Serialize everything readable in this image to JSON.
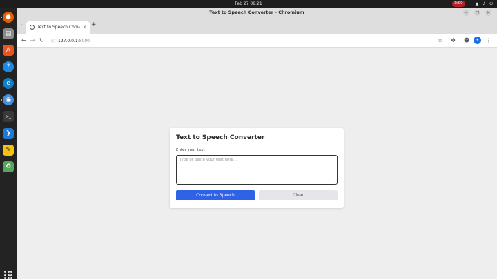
{
  "system": {
    "clock": "Feb 27  08:21",
    "recording_badge": "0:00"
  },
  "dock": {
    "apps": [
      {
        "name": "firefox-icon",
        "color": "#e66000"
      },
      {
        "name": "files-icon",
        "color": "#8a8a8a"
      },
      {
        "name": "app-center-icon",
        "color": "#e95420"
      },
      {
        "name": "help-icon",
        "color": "#1e88e5"
      },
      {
        "name": "edge-icon",
        "color": "#0f7fc7"
      },
      {
        "name": "chromium-icon",
        "color": "#4a90d9"
      },
      {
        "name": "terminal-icon",
        "color": "#3a3a3a"
      },
      {
        "name": "vscode-icon",
        "color": "#1f7ad6"
      },
      {
        "name": "notes-icon",
        "color": "#f5c211"
      },
      {
        "name": "trash-icon",
        "color": "#58a55c"
      }
    ]
  },
  "browser": {
    "window_title": "Text to Speech Converter - Chromium",
    "tab_title": "Text to Speech Conver",
    "url_host": "127.0.0.1",
    "url_port": ":8000",
    "profile_initial": "•"
  },
  "app": {
    "heading": "Text to Speech Converter",
    "input_label": "Enter your text",
    "placeholder": "Type or paste your text here...",
    "convert_label": "Convert to Speech",
    "clear_label": "Clear",
    "accent_color": "#2f62e6"
  }
}
